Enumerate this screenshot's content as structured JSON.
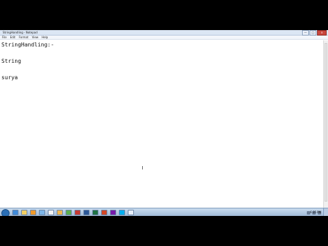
{
  "window": {
    "title": "StringHandling - Notepad",
    "controls": [
      "—",
      "□",
      "x"
    ]
  },
  "menu": [
    "File",
    "Edit",
    "Format",
    "View",
    "Help"
  ],
  "editor": {
    "lines": [
      "StringHandling:-",
      "",
      "",
      "String",
      "",
      "",
      "surya"
    ]
  },
  "taskbar": {
    "clock": "6:35 PM",
    "icons": [
      "ie-icon",
      "explorer-icon",
      "media-player-icon",
      "paint-icon",
      "notepad-icon",
      "folder-icon",
      "chrome-icon",
      "acrobat-icon",
      "word-icon",
      "excel-icon",
      "powerpoint-icon",
      "onenote-icon",
      "skype-icon",
      "notepad-icon"
    ]
  }
}
